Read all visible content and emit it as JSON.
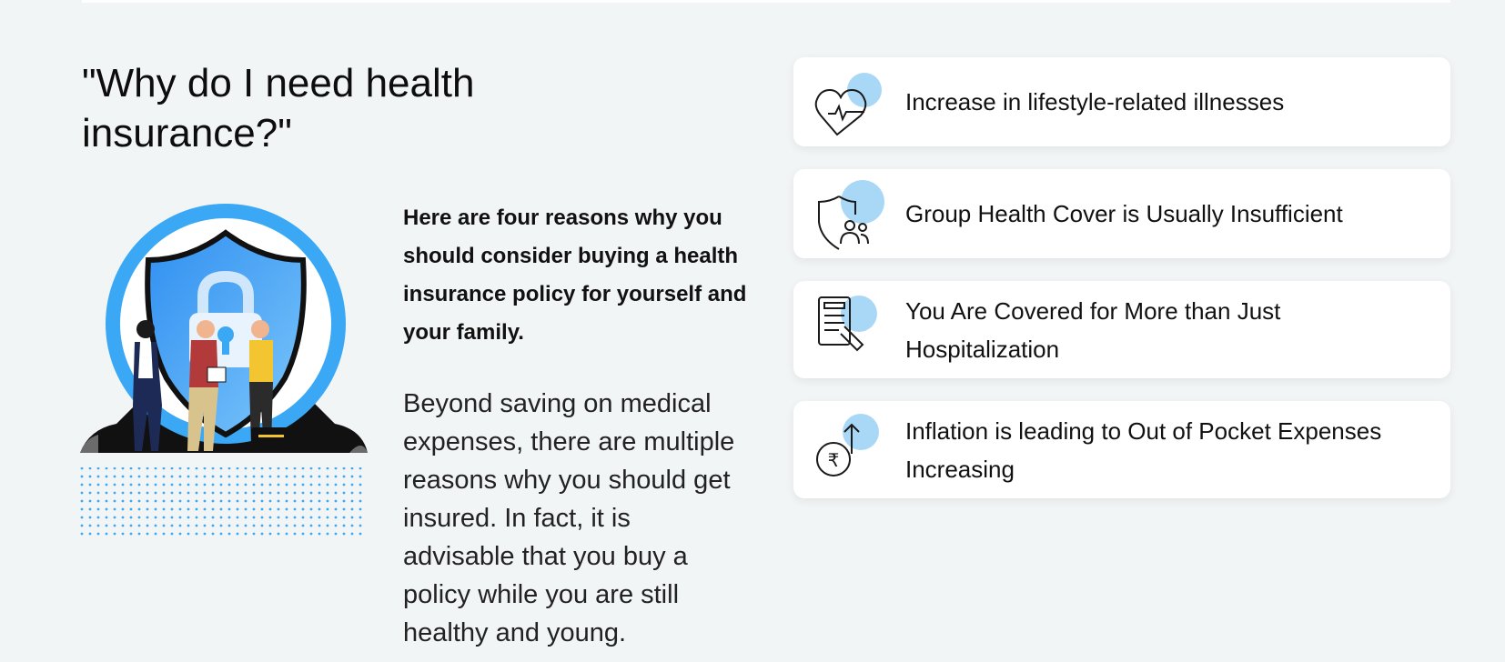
{
  "section": {
    "title": "\"Why do I need health insurance?\"",
    "intro_bold": "Here are four reasons why you should consider buying a health insurance policy for yourself and your family.",
    "intro_body": "Beyond saving on medical expenses, there are multiple reasons why you should get insured. In fact, it is advisable that you buy a policy while you are still healthy and young."
  },
  "reasons": [
    {
      "icon": "heart-pulse-icon",
      "text": "Increase in lifestyle-related illnesses"
    },
    {
      "icon": "shield-group-icon",
      "text": "Group Health Cover is Usually Insufficient"
    },
    {
      "icon": "medical-report-icon",
      "text": "You Are Covered for More than Just Hospitalization"
    },
    {
      "icon": "rupee-rising-icon",
      "text": "Inflation is leading to Out of Pocket Expenses Increasing"
    }
  ],
  "colors": {
    "background": "#f2f5f6",
    "accent_blue": "#3aa8f5",
    "icon_bubble": "#a9d8f7",
    "card": "#ffffff"
  }
}
